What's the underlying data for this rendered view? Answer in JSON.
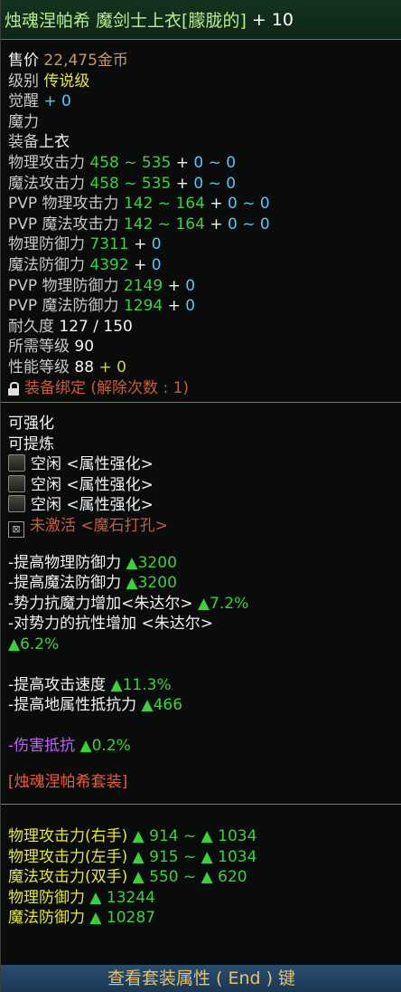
{
  "title": {
    "name": "烛魂涅帕希 魔剑士上衣[朦胧的]",
    "plus": "+ 10"
  },
  "basic": {
    "price_label": "售价",
    "price_value": "22,475金币",
    "grade_label": "级别",
    "grade_value": "传说级",
    "awaken_label": "觉醒",
    "awaken_value": "+ 0",
    "magic_label": "魔力",
    "equip_label": "装备",
    "equip_value": "上衣"
  },
  "stats": [
    {
      "label": "物理攻击力",
      "value": "458 ~ 535",
      "bonus": "0 ~ 0"
    },
    {
      "label": "魔法攻击力",
      "value": "458 ~ 535",
      "bonus": "0 ~ 0"
    },
    {
      "label": "PVP 物理攻击力",
      "value": "142 ~ 164",
      "bonus": "0 ~ 0"
    },
    {
      "label": "PVP 魔法攻击力",
      "value": "142 ~ 164",
      "bonus": "0 ~ 0"
    },
    {
      "label": "物理防御力",
      "value": "7311",
      "bonus": "0"
    },
    {
      "label": "魔法防御力",
      "value": "4392",
      "bonus": "0"
    },
    {
      "label": "PVP 物理防御力",
      "value": "2149",
      "bonus": "0"
    },
    {
      "label": "PVP 魔法防御力",
      "value": "1294",
      "bonus": "0"
    }
  ],
  "durability": {
    "label": "耐久度",
    "value": "127 / 150"
  },
  "req_level": {
    "label": "所需等级",
    "value": "90"
  },
  "perf_level": {
    "label": "性能等级",
    "value": "88",
    "bonus": "+ 0"
  },
  "binding": {
    "text": "装备绑定 (解除次数 : 1)"
  },
  "enhance": {
    "line1": "可强化",
    "line2": "可提炼"
  },
  "sockets": [
    {
      "status": "空闲",
      "type": "<属性强化>"
    },
    {
      "status": "空闲",
      "type": "<属性强化>"
    },
    {
      "status": "空闲",
      "type": "<属性强化>"
    }
  ],
  "inactive_socket": {
    "status": "未激活",
    "type": "<魔石打孔>"
  },
  "options_a": [
    {
      "label": "-提高物理防御力",
      "value": "▲3200"
    },
    {
      "label": "-提高魔法防御力",
      "value": "▲3200"
    },
    {
      "label": "-势力抗魔力增加<朱达尔>",
      "value": "▲7.2%"
    }
  ],
  "option_resist": {
    "label": "-对势力的抗性增加  <朱达尔>",
    "value": "▲6.2%"
  },
  "options_b": [
    {
      "label": "-提高攻击速度",
      "value": "▲11.3%"
    },
    {
      "label": "-提高地属性抵抗力",
      "value": "▲466"
    }
  ],
  "damage_resist": {
    "label": "-伤害抵抗",
    "value": "▲0.2%"
  },
  "set_name": "[烛魂涅帕希套装]",
  "set_stats": [
    {
      "label": "物理攻击力(右手)",
      "value": "▲ 914 ~ ▲ 1034"
    },
    {
      "label": "物理攻击力(左手)",
      "value": "▲ 915 ~ ▲ 1034"
    },
    {
      "label": "魔法攻击力(双手)",
      "value": "▲ 550 ~ ▲ 620"
    },
    {
      "label": "物理防御力",
      "value": "▲ 13244"
    },
    {
      "label": "魔法防御力",
      "value": "▲ 10287"
    }
  ],
  "footer": {
    "text": "查看套装属性 ( End ) 键"
  },
  "colors": {
    "title_green": "#b6f08c",
    "stat_green": "#3ad23a",
    "bonus_cyan": "#55c8f0",
    "option_purple": "#c060ff",
    "set_red": "#f05a3c",
    "footer_gold": "#e8c064"
  }
}
